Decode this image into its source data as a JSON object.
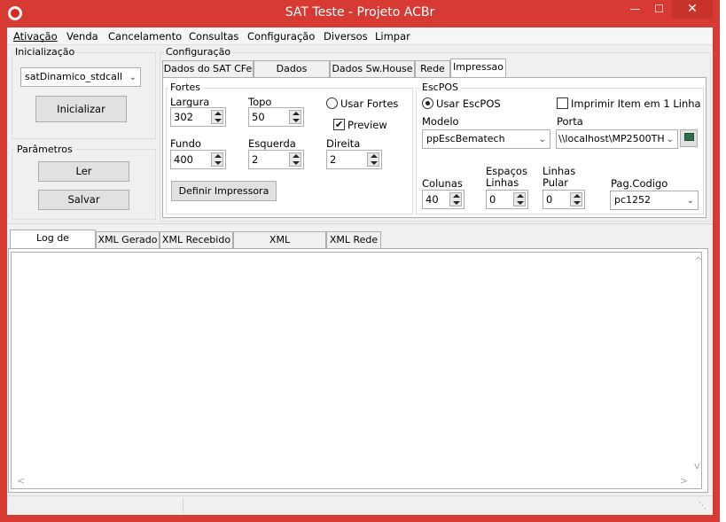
{
  "window": {
    "title": "SAT Teste - Projeto ACBr",
    "minimize": "—",
    "maximize": "☐",
    "close": "✕"
  },
  "menu": [
    "Ativação",
    "Venda",
    "Cancelamento",
    "Consultas",
    "Configuração",
    "Diversos",
    "Limpar"
  ],
  "inicializacao": {
    "group_label": "Inicialização",
    "library_selected": "satDinamico_stdcall",
    "init_button": "Inicializar"
  },
  "parametros": {
    "group_label": "Parâmetros",
    "read_button": "Ler",
    "save_button": "Salvar"
  },
  "configuracao": {
    "group_label": "Configuração",
    "tabs": [
      "Dados do SAT CFe",
      "Dados Emitente",
      "Dados Sw.House",
      "Rede",
      "Impressao"
    ],
    "active_tab": "Impressao"
  },
  "fortes": {
    "group_label": "Fortes",
    "largura_label": "Largura",
    "largura_value": "302",
    "topo_label": "Topo",
    "topo_value": "50",
    "usar_fortes_label": "Usar Fortes",
    "usar_fortes_checked": false,
    "preview_label": "Preview",
    "preview_checked": true,
    "fundo_label": "Fundo",
    "fundo_value": "400",
    "esquerda_label": "Esquerda",
    "esquerda_value": "2",
    "direita_label": "Direita",
    "direita_value": "2",
    "define_button": "Definir Impressora"
  },
  "escpos": {
    "group_label": "EscPOS",
    "usar_label": "Usar EscPOS",
    "usar_checked": true,
    "imprimir_item_label": "Imprimir Item em 1 Linha",
    "imprimir_item_checked": false,
    "modelo_label": "Modelo",
    "modelo_value": "ppEscBematech",
    "porta_label": "Porta",
    "porta_value": "\\\\localhost\\MP2500TH",
    "colunas_label": "Colunas",
    "colunas_value": "40",
    "espacos_label": "Espaços\nLinhas",
    "espacos_value": "0",
    "linhas_label": "Linhas\nPular",
    "linhas_value": "0",
    "pagcodigo_label": "Pag.Codigo",
    "pagcodigo_value": "pc1252"
  },
  "bottom_tabs": [
    "Log de Comandos",
    "XML Gerado",
    "XML Recebido",
    "XML Cancelamento",
    "XML Rede"
  ],
  "bottom_active_tab": "Log de Comandos",
  "log_text": "",
  "icons": {
    "scroll_up": "^",
    "scroll_down": "v",
    "scroll_left": "<",
    "scroll_right": ">"
  }
}
